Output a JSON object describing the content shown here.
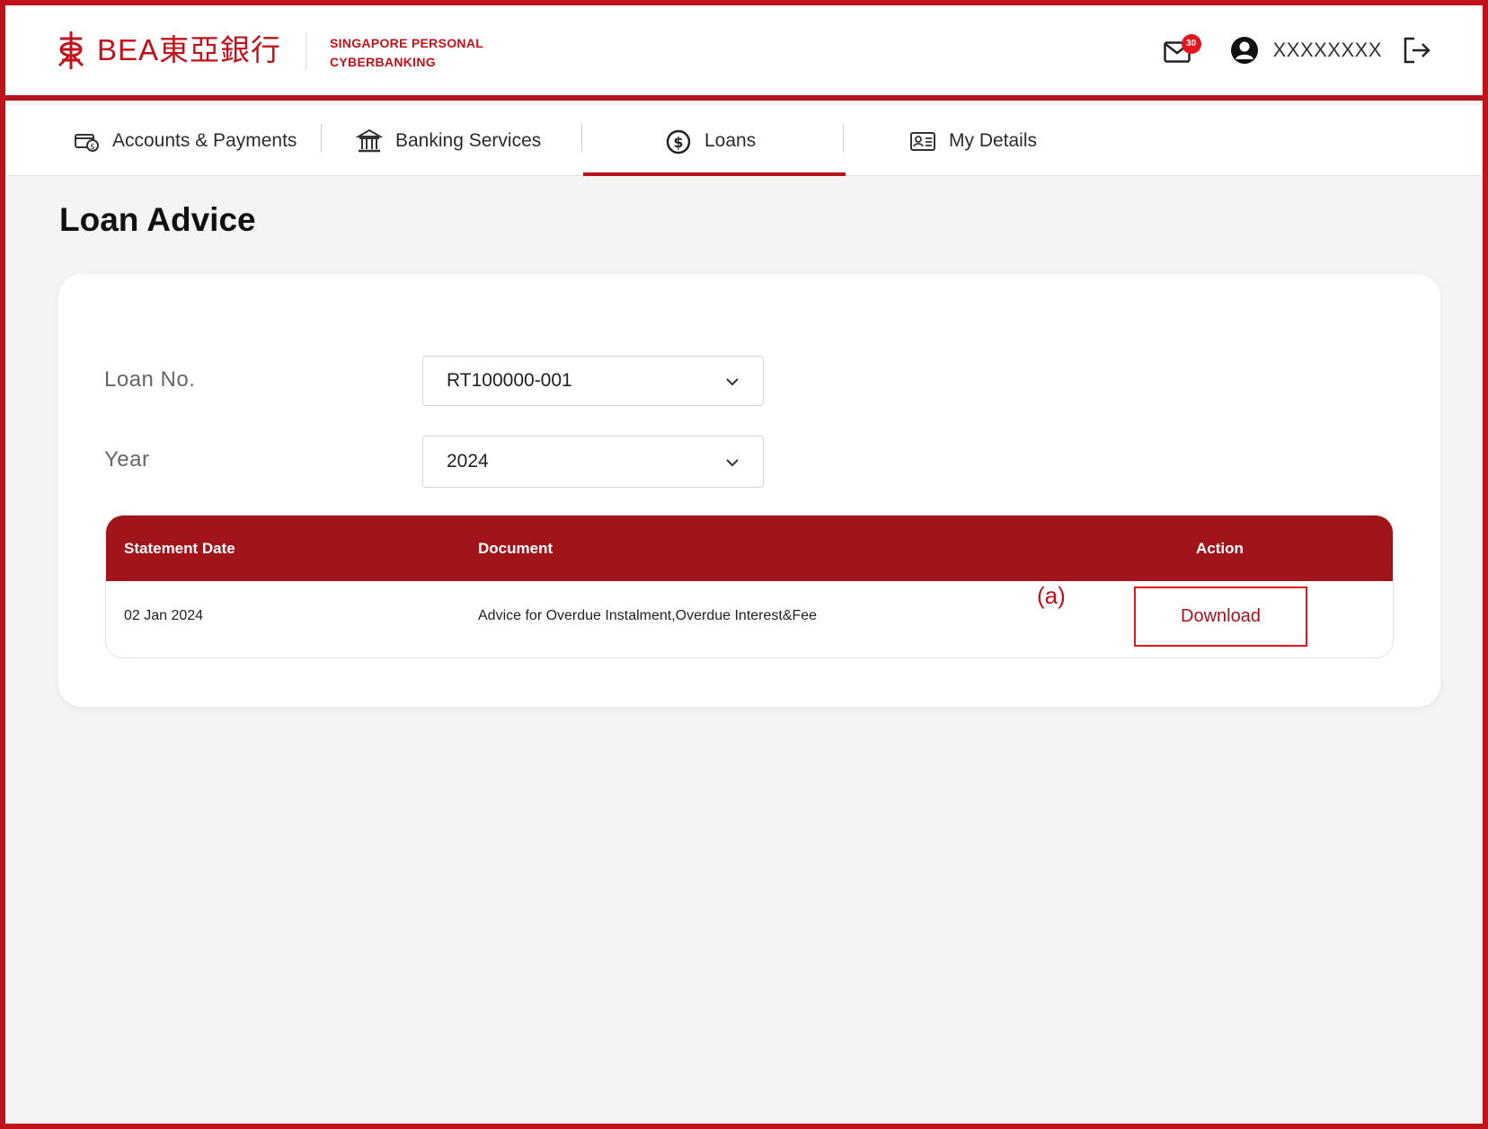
{
  "header": {
    "brand_text": "BEA東亞銀行",
    "subtitle_line1": "SINGAPORE PERSONAL",
    "subtitle_line2": "CYBERBANKING",
    "mail_badge": "30",
    "user_name": "XXXXXXXX"
  },
  "nav": {
    "items": [
      {
        "label": "Accounts & Payments",
        "icon": "wallet-icon"
      },
      {
        "label": "Banking Services",
        "icon": "bank-icon"
      },
      {
        "label": "Loans",
        "icon": "dollar-coin-icon",
        "active": true
      },
      {
        "label": "My Details",
        "icon": "id-card-icon"
      }
    ]
  },
  "page": {
    "title": "Loan Advice"
  },
  "form": {
    "loan_label": "Loan No.",
    "loan_value": "RT100000-001",
    "year_label": "Year",
    "year_value": "2024"
  },
  "table": {
    "headers": [
      "Statement Date",
      "Document",
      "Action"
    ],
    "rows": [
      {
        "date": "02 Jan 2024",
        "document": "Advice for Overdue Instalment,Overdue Interest&Fee",
        "action": "Download"
      }
    ]
  },
  "annotation": "(a)",
  "colors": {
    "brand_red": "#c0121a",
    "table_header": "#a0141a",
    "page_bg": "#f4f4f4"
  }
}
